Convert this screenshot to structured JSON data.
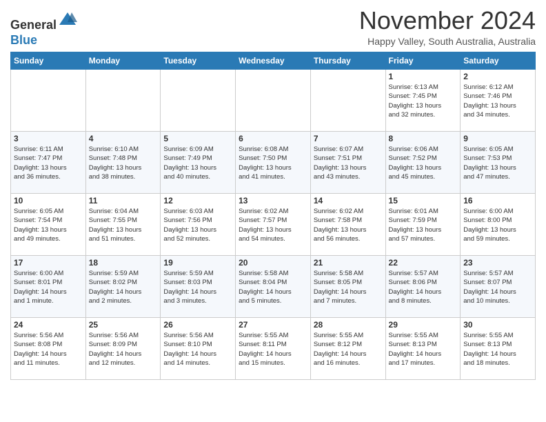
{
  "header": {
    "logo_line1": "General",
    "logo_line2": "Blue",
    "month": "November 2024",
    "location": "Happy Valley, South Australia, Australia"
  },
  "days_of_week": [
    "Sunday",
    "Monday",
    "Tuesday",
    "Wednesday",
    "Thursday",
    "Friday",
    "Saturday"
  ],
  "weeks": [
    [
      {
        "day": "",
        "info": ""
      },
      {
        "day": "",
        "info": ""
      },
      {
        "day": "",
        "info": ""
      },
      {
        "day": "",
        "info": ""
      },
      {
        "day": "",
        "info": ""
      },
      {
        "day": "1",
        "info": "Sunrise: 6:13 AM\nSunset: 7:45 PM\nDaylight: 13 hours\nand 32 minutes."
      },
      {
        "day": "2",
        "info": "Sunrise: 6:12 AM\nSunset: 7:46 PM\nDaylight: 13 hours\nand 34 minutes."
      }
    ],
    [
      {
        "day": "3",
        "info": "Sunrise: 6:11 AM\nSunset: 7:47 PM\nDaylight: 13 hours\nand 36 minutes."
      },
      {
        "day": "4",
        "info": "Sunrise: 6:10 AM\nSunset: 7:48 PM\nDaylight: 13 hours\nand 38 minutes."
      },
      {
        "day": "5",
        "info": "Sunrise: 6:09 AM\nSunset: 7:49 PM\nDaylight: 13 hours\nand 40 minutes."
      },
      {
        "day": "6",
        "info": "Sunrise: 6:08 AM\nSunset: 7:50 PM\nDaylight: 13 hours\nand 41 minutes."
      },
      {
        "day": "7",
        "info": "Sunrise: 6:07 AM\nSunset: 7:51 PM\nDaylight: 13 hours\nand 43 minutes."
      },
      {
        "day": "8",
        "info": "Sunrise: 6:06 AM\nSunset: 7:52 PM\nDaylight: 13 hours\nand 45 minutes."
      },
      {
        "day": "9",
        "info": "Sunrise: 6:05 AM\nSunset: 7:53 PM\nDaylight: 13 hours\nand 47 minutes."
      }
    ],
    [
      {
        "day": "10",
        "info": "Sunrise: 6:05 AM\nSunset: 7:54 PM\nDaylight: 13 hours\nand 49 minutes."
      },
      {
        "day": "11",
        "info": "Sunrise: 6:04 AM\nSunset: 7:55 PM\nDaylight: 13 hours\nand 51 minutes."
      },
      {
        "day": "12",
        "info": "Sunrise: 6:03 AM\nSunset: 7:56 PM\nDaylight: 13 hours\nand 52 minutes."
      },
      {
        "day": "13",
        "info": "Sunrise: 6:02 AM\nSunset: 7:57 PM\nDaylight: 13 hours\nand 54 minutes."
      },
      {
        "day": "14",
        "info": "Sunrise: 6:02 AM\nSunset: 7:58 PM\nDaylight: 13 hours\nand 56 minutes."
      },
      {
        "day": "15",
        "info": "Sunrise: 6:01 AM\nSunset: 7:59 PM\nDaylight: 13 hours\nand 57 minutes."
      },
      {
        "day": "16",
        "info": "Sunrise: 6:00 AM\nSunset: 8:00 PM\nDaylight: 13 hours\nand 59 minutes."
      }
    ],
    [
      {
        "day": "17",
        "info": "Sunrise: 6:00 AM\nSunset: 8:01 PM\nDaylight: 14 hours\nand 1 minute."
      },
      {
        "day": "18",
        "info": "Sunrise: 5:59 AM\nSunset: 8:02 PM\nDaylight: 14 hours\nand 2 minutes."
      },
      {
        "day": "19",
        "info": "Sunrise: 5:59 AM\nSunset: 8:03 PM\nDaylight: 14 hours\nand 3 minutes."
      },
      {
        "day": "20",
        "info": "Sunrise: 5:58 AM\nSunset: 8:04 PM\nDaylight: 14 hours\nand 5 minutes."
      },
      {
        "day": "21",
        "info": "Sunrise: 5:58 AM\nSunset: 8:05 PM\nDaylight: 14 hours\nand 7 minutes."
      },
      {
        "day": "22",
        "info": "Sunrise: 5:57 AM\nSunset: 8:06 PM\nDaylight: 14 hours\nand 8 minutes."
      },
      {
        "day": "23",
        "info": "Sunrise: 5:57 AM\nSunset: 8:07 PM\nDaylight: 14 hours\nand 10 minutes."
      }
    ],
    [
      {
        "day": "24",
        "info": "Sunrise: 5:56 AM\nSunset: 8:08 PM\nDaylight: 14 hours\nand 11 minutes."
      },
      {
        "day": "25",
        "info": "Sunrise: 5:56 AM\nSunset: 8:09 PM\nDaylight: 14 hours\nand 12 minutes."
      },
      {
        "day": "26",
        "info": "Sunrise: 5:56 AM\nSunset: 8:10 PM\nDaylight: 14 hours\nand 14 minutes."
      },
      {
        "day": "27",
        "info": "Sunrise: 5:55 AM\nSunset: 8:11 PM\nDaylight: 14 hours\nand 15 minutes."
      },
      {
        "day": "28",
        "info": "Sunrise: 5:55 AM\nSunset: 8:12 PM\nDaylight: 14 hours\nand 16 minutes."
      },
      {
        "day": "29",
        "info": "Sunrise: 5:55 AM\nSunset: 8:13 PM\nDaylight: 14 hours\nand 17 minutes."
      },
      {
        "day": "30",
        "info": "Sunrise: 5:55 AM\nSunset: 8:13 PM\nDaylight: 14 hours\nand 18 minutes."
      }
    ]
  ]
}
